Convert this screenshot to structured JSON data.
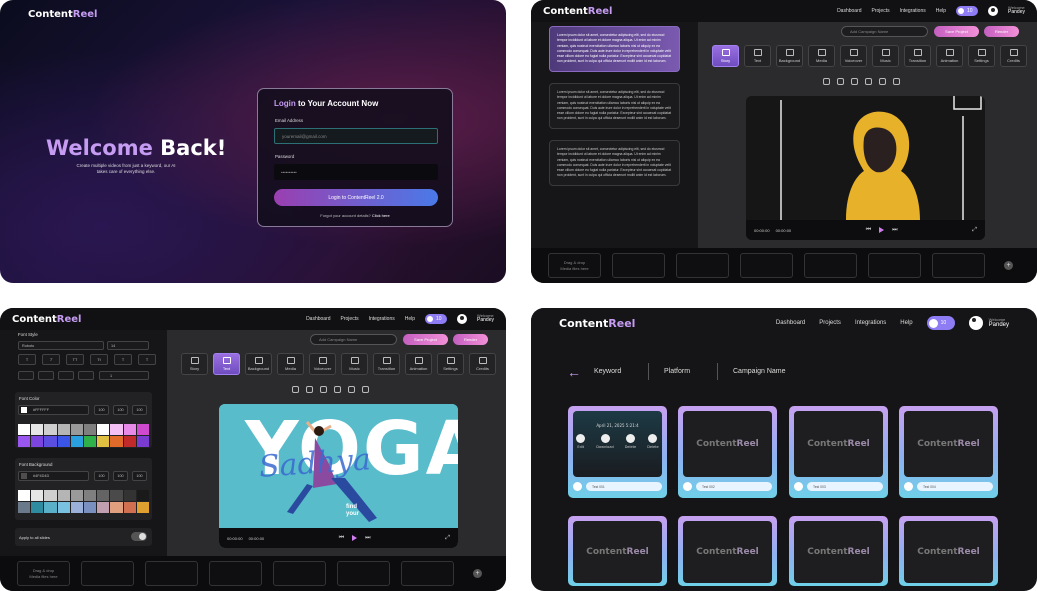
{
  "panel1": {
    "logo": {
      "a": "Content",
      "b": "Reel"
    },
    "welcome": {
      "a": "Welcome",
      "b": "Back!"
    },
    "tagline": "Create multiple videos from just a keyword, our AI\ntakes care of everything else.",
    "login": {
      "title_hl": "Login",
      "title_rest": " to Your Account Now",
      "email_label": "Email Address",
      "email_value": "youremail@gmail.com",
      "password_label": "Password",
      "password_value": "••••••••••",
      "button": "Login to ContentReel 2.0",
      "forgot": "Forgot your account details?",
      "click_here": "Click here"
    }
  },
  "header": {
    "logo": {
      "a": "Content",
      "b": "Reel"
    },
    "nav": [
      "Dashboard",
      "Projects",
      "Integrations",
      "Help"
    ],
    "credits": "10",
    "user_greeting": "Welcome",
    "user_name": "Pandey"
  },
  "panel2": {
    "search_placeholder": "Add Campaign Name",
    "save_project": "Save Project",
    "render": "Render",
    "scripts": [
      "Lorem ipsum dolor sit amet, consectetur adipiscing elit, sed do eiusmod tempor incididunt ut labore et dolore magna aliqua. Ut enim ad minim veniam, quis nostrud exercitation ullamco laboris nisi ut aliquip ex ea commodo consequat. Duis aute irure dolor in reprehenderit in voluptate velit esse cillum dolore eu fugiat nulla pariatur. Excepteur sint occaecat cupidatat non proident, sunt in culpa qui officia deserunt mollit anim id est laborum.",
      "Lorem ipsum dolor sit amet, consectetur adipiscing elit, sed do eiusmod tempor incididunt ut labore et dolore magna aliqua. Ut enim ad minim veniam, quis nostrud exercitation ullamco laboris nisi ut aliquip ex ea commodo consequat. Duis aute irure dolor in reprehenderit in voluptate velit esse cillum dolore eu fugiat nulla pariatur. Excepteur sint occaecat cupidatat non proident, sunt in culpa qui officia deserunt mollit anim id est laborum.",
      "Lorem ipsum dolor sit amet, consectetur adipiscing elit, sed do eiusmod tempor incididunt ut labore et dolore magna aliqua. Ut enim ad minim veniam, quis nostrud exercitation ullamco laboris nisi ut aliquip ex ea commodo consequat. Duis aute irure dolor in reprehenderit in voluptate velit esse cillum dolore eu fugiat nulla pariatur. Excepteur sint occaecat cupidatat non proident, sunt in culpa qui officia deserunt mollit anim id est laborum."
    ],
    "tools": [
      "Story",
      "Text",
      "Background",
      "Media",
      "Voiceover",
      "Music",
      "Transition",
      "Animation",
      "Settings",
      "Credits"
    ],
    "time_start": "00:00:00",
    "time_end": "00:00:00",
    "drop_hint": "Drag & drop\nMedia files here"
  },
  "panel3": {
    "font_style": "Font Style",
    "font_family": "Roboto",
    "font_size": "14",
    "style_buttons": [
      "T",
      "T",
      "TT",
      "Tt",
      "T",
      "T"
    ],
    "letter_spacing": "1",
    "font_color": "Font Color",
    "font_color_hex": "#FFFFFF",
    "pct": [
      "100",
      "100",
      "100"
    ],
    "font_background": "Font Background",
    "font_bg_hex": "#4F4D4D",
    "apply_all": "Apply to all slides",
    "tools": [
      "Story",
      "Text",
      "Background",
      "Media",
      "Voiceover",
      "Music",
      "Transition",
      "Animation",
      "Settings",
      "Credits"
    ],
    "yoga_word": "YOGA",
    "yoga_script": "Sadhya",
    "find": "find\nyour",
    "time_start": "00:00:00",
    "time_end": "00:00:00",
    "drop_hint": "Drag & drop\nMedia files here",
    "swatch_colors_1": [
      "#ffffff",
      "#e6e6e6",
      "#cfcfcf",
      "#b5b5b5",
      "#9a9a9a",
      "#7f7f7f",
      "#ffffff",
      "#f3c0f3",
      "#e88ae8",
      "#d04ad0",
      "#9a57f0",
      "#7d45e0",
      "#5a4fe0",
      "#3b55e8",
      "#2aa0e0",
      "#2fb04a",
      "#e0c040",
      "#e06a2a",
      "#c02a2a",
      "#7a3cd0"
    ],
    "swatch_colors_2": [
      "#ffffff",
      "#e6e6e6",
      "#cfcfcf",
      "#b5b5b5",
      "#9a9a9a",
      "#7f7f7f",
      "#646464",
      "#4a4a4a",
      "#333333",
      "#1a1a1a",
      "#6a7a8a",
      "#2f8ca0",
      "#5ab0c8",
      "#7ac0e0",
      "#9ab0d8",
      "#7a90c0",
      "#c0a0b0",
      "#e0a080",
      "#d07050",
      "#e0a030"
    ]
  },
  "panel4": {
    "back": "←",
    "keyword": "Keyword",
    "platform": "Platform",
    "campaign": "Campaign Name",
    "card_logo": {
      "a": "Content",
      "b": "Reel"
    },
    "first_card_date": "April 21, 2025 5:21:4",
    "actions": [
      "Edit",
      "Download",
      "Delete",
      "Delete"
    ],
    "card_labels": [
      "Test 001",
      "Test 002",
      "Test 003",
      "Test 004"
    ]
  }
}
